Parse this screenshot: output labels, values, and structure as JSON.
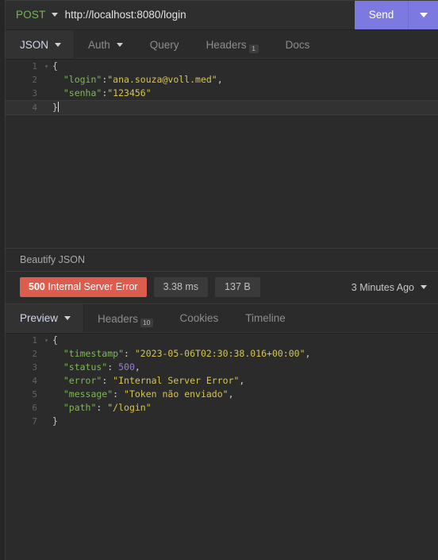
{
  "request_bar": {
    "method": "POST",
    "method_caret_icon": "chevron-down-icon",
    "url": "http://localhost:8080/login",
    "send_label": "Send",
    "send_caret_icon": "chevron-down-icon"
  },
  "request_tabs": [
    {
      "label": "JSON",
      "active": true,
      "has_caret": true,
      "badge": ""
    },
    {
      "label": "Auth",
      "active": false,
      "has_caret": true,
      "badge": ""
    },
    {
      "label": "Query",
      "active": false,
      "has_caret": false,
      "badge": ""
    },
    {
      "label": "Headers",
      "active": false,
      "has_caret": false,
      "badge": "1"
    },
    {
      "label": "Docs",
      "active": false,
      "has_caret": false,
      "badge": ""
    }
  ],
  "request_body": {
    "lines": [
      {
        "no": "1",
        "fold": "▾",
        "tokens": [
          {
            "t": "{",
            "c": "tk-brace"
          }
        ],
        "active": false
      },
      {
        "no": "2",
        "fold": "",
        "tokens": [
          {
            "t": "  \"login\"",
            "c": "tk-key"
          },
          {
            "t": ":",
            "c": "tk-punc"
          },
          {
            "t": "\"ana.souza@voll.med\"",
            "c": "tk-str"
          },
          {
            "t": ",",
            "c": "tk-punc"
          }
        ],
        "active": false
      },
      {
        "no": "3",
        "fold": "",
        "tokens": [
          {
            "t": "  \"senha\"",
            "c": "tk-key"
          },
          {
            "t": ":",
            "c": "tk-punc"
          },
          {
            "t": "\"123456\"",
            "c": "tk-str"
          }
        ],
        "active": false
      },
      {
        "no": "4",
        "fold": "",
        "tokens": [
          {
            "t": "}",
            "c": "tk-brace"
          }
        ],
        "active": true
      }
    ]
  },
  "beautify": {
    "label": "Beautify JSON"
  },
  "status": {
    "code": "500",
    "code_text": "Internal Server Error",
    "duration": "3.38 ms",
    "size": "137 B",
    "time_ago": "3 Minutes Ago",
    "time_caret_icon": "chevron-down-icon",
    "pill_color": "#dc5c4e"
  },
  "response_tabs": [
    {
      "label": "Preview",
      "active": true,
      "has_caret": true,
      "badge": ""
    },
    {
      "label": "Headers",
      "active": false,
      "has_caret": false,
      "badge": "10"
    },
    {
      "label": "Cookies",
      "active": false,
      "has_caret": false,
      "badge": ""
    },
    {
      "label": "Timeline",
      "active": false,
      "has_caret": false,
      "badge": ""
    }
  ],
  "response_body": {
    "lines": [
      {
        "no": "1",
        "fold": "▾",
        "tokens": [
          {
            "t": "{",
            "c": "tk-brace"
          }
        ],
        "active": false
      },
      {
        "no": "2",
        "fold": "",
        "tokens": [
          {
            "t": "  \"timestamp\"",
            "c": "tk-key"
          },
          {
            "t": ": ",
            "c": "tk-punc"
          },
          {
            "t": "\"2023-05-06T02:30:38.016+00:00\"",
            "c": "tk-str"
          },
          {
            "t": ",",
            "c": "tk-punc"
          }
        ],
        "active": false
      },
      {
        "no": "3",
        "fold": "",
        "tokens": [
          {
            "t": "  \"status\"",
            "c": "tk-key"
          },
          {
            "t": ": ",
            "c": "tk-punc"
          },
          {
            "t": "500",
            "c": "tk-num"
          },
          {
            "t": ",",
            "c": "tk-punc"
          }
        ],
        "active": false
      },
      {
        "no": "4",
        "fold": "",
        "tokens": [
          {
            "t": "  \"error\"",
            "c": "tk-key"
          },
          {
            "t": ": ",
            "c": "tk-punc"
          },
          {
            "t": "\"Internal Server Error\"",
            "c": "tk-str"
          },
          {
            "t": ",",
            "c": "tk-punc"
          }
        ],
        "active": false
      },
      {
        "no": "5",
        "fold": "",
        "tokens": [
          {
            "t": "  \"message\"",
            "c": "tk-key"
          },
          {
            "t": ": ",
            "c": "tk-punc"
          },
          {
            "t": "\"Token não enviado\"",
            "c": "tk-str"
          },
          {
            "t": ",",
            "c": "tk-punc"
          }
        ],
        "active": false
      },
      {
        "no": "6",
        "fold": "",
        "tokens": [
          {
            "t": "  \"path\"",
            "c": "tk-key"
          },
          {
            "t": ": ",
            "c": "tk-punc"
          },
          {
            "t": "\"/login\"",
            "c": "tk-str"
          }
        ],
        "active": false
      },
      {
        "no": "7",
        "fold": "",
        "tokens": [
          {
            "t": "}",
            "c": "tk-brace"
          }
        ],
        "active": false
      }
    ]
  }
}
